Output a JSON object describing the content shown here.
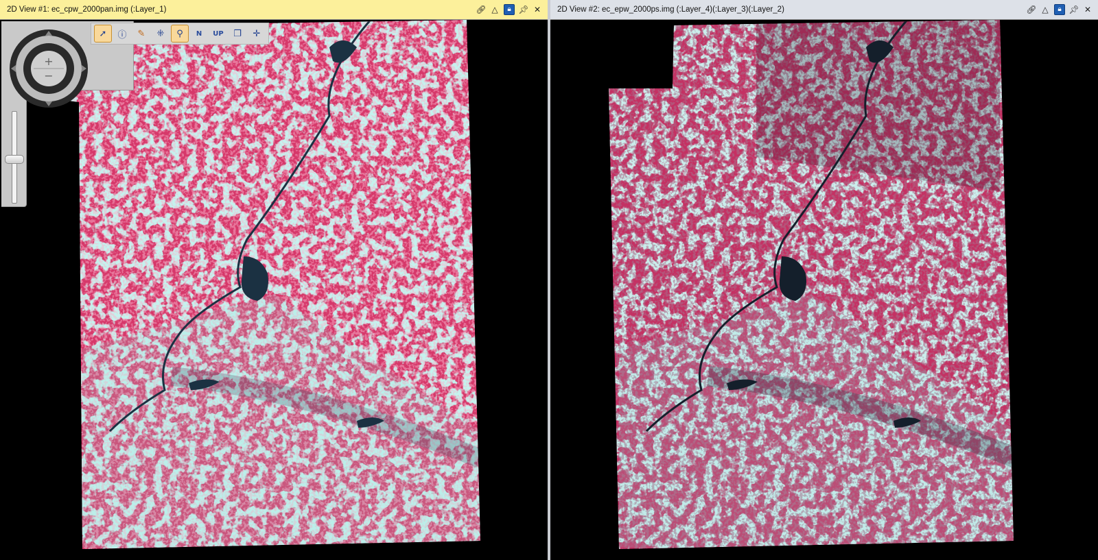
{
  "view1": {
    "title": "2D View #1: ec_cpw_2000pan.img (:Layer_1)",
    "title_bg": "#fcf09b"
  },
  "view2": {
    "title": "2D View #2: ec_epw_2000ps.img (:Layer_4)(:Layer_3)(:Layer_2)",
    "title_bg": "#dde1e8"
  },
  "titlebar_icons": {
    "link": "link-icon",
    "warning": "warning-triangle-icon",
    "lock": "lock-icon",
    "pin": "pin-icon",
    "close": "close-icon"
  },
  "navigation": {
    "zoom_in": "+",
    "zoom_out": "−"
  },
  "toolbar": {
    "tools": [
      {
        "name": "select-pointer-tool",
        "icon": "pointer-icon"
      },
      {
        "name": "info-tool",
        "icon": "info-icon"
      },
      {
        "name": "paint-tool",
        "icon": "paint-icon"
      },
      {
        "name": "fit-extent-tool",
        "icon": "fit-icon"
      },
      {
        "name": "magnifier-tool",
        "icon": "magnifier-icon"
      },
      {
        "name": "north-up-tool",
        "label": "N"
      },
      {
        "name": "up-tool",
        "label": "UP"
      },
      {
        "name": "layers-tool",
        "icon": "layers-icon"
      },
      {
        "name": "crosshair-tool",
        "icon": "crosshair-icon"
      }
    ]
  },
  "colors": {
    "vegetation": "#d6386a",
    "urban_soil": "#8fe3da",
    "water": "#1b3142",
    "nodata": "#000000"
  }
}
